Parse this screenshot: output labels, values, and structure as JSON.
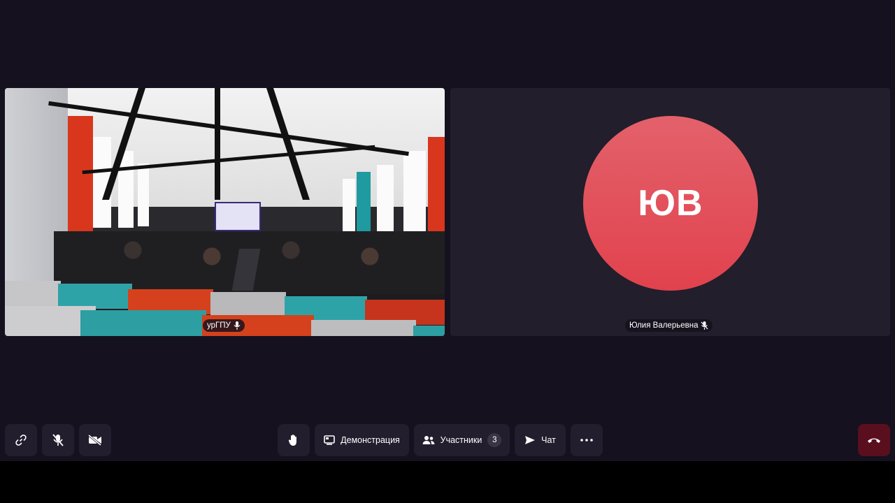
{
  "participants": [
    {
      "name": "урГПУ",
      "mic_state": "on",
      "video": "on"
    },
    {
      "name": "Юлия Валерьевна",
      "mic_state": "muted",
      "video": "off",
      "initials": "ЮВ",
      "avatar_color": "#e1424d"
    }
  ],
  "toolbar": {
    "copy_link": {
      "icon": "link-icon"
    },
    "microphone": {
      "icon": "mic-off-icon",
      "state": "off"
    },
    "camera": {
      "icon": "camera-off-icon",
      "state": "off"
    },
    "raise_hand": {
      "icon": "hand-icon"
    },
    "screen_share": {
      "icon": "screen-share-icon",
      "label": "Демонстрация"
    },
    "participants": {
      "icon": "users-icon",
      "label": "Участники",
      "count": "3"
    },
    "chat": {
      "icon": "send-icon",
      "label": "Чат"
    },
    "more": {
      "icon": "more-icon"
    },
    "hangup": {
      "icon": "phone-hangup-icon",
      "color": "#5a0f1f"
    }
  },
  "colors": {
    "background": "#15111f",
    "button_bg": "#231e2d",
    "avatar": "#e1424d"
  }
}
